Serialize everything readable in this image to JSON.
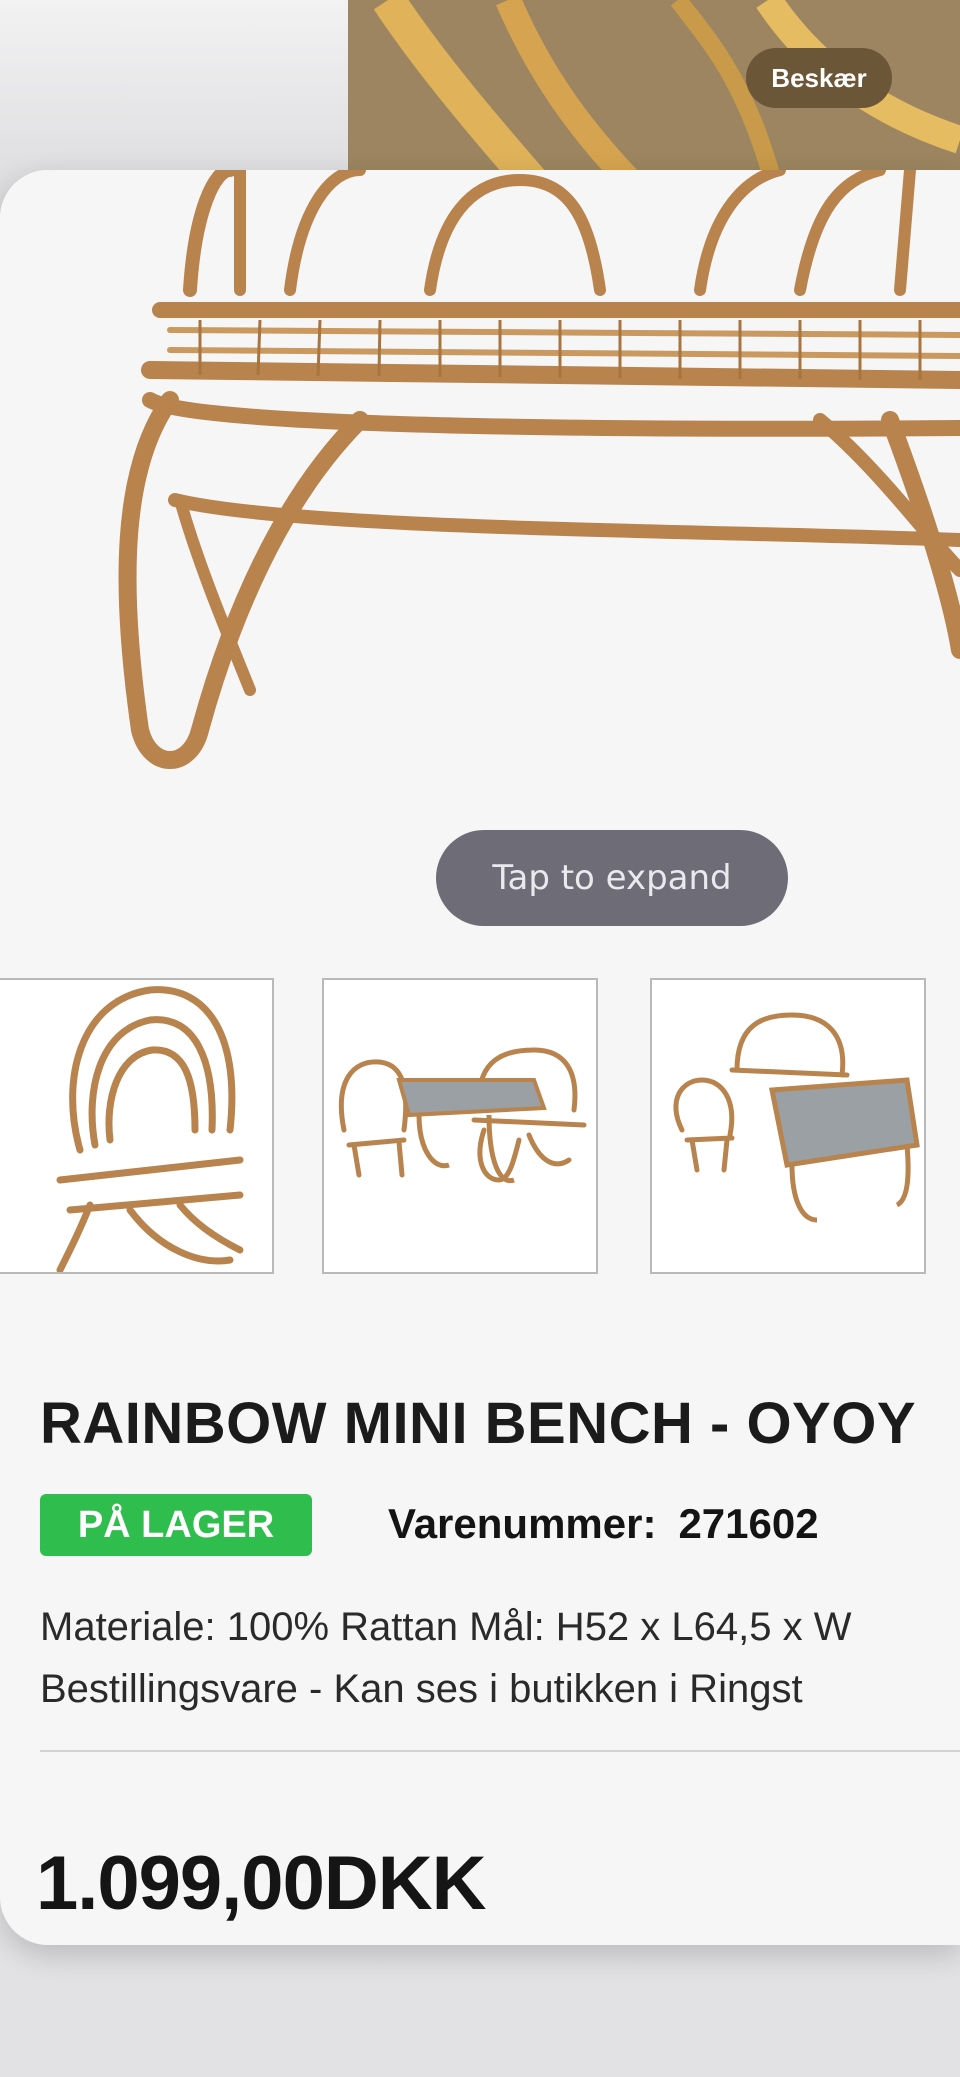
{
  "toolbar": {
    "crop_label": "Beskær"
  },
  "gallery": {
    "expand_label": "Tap to expand"
  },
  "product": {
    "title": "RAINBOW MINI BENCH - OYOY",
    "stock_label": "PÅ LAGER",
    "sku_label": "Varenummer:",
    "sku_value": "271602",
    "description_line1": "Materiale: 100% Rattan Mål: H52 x L64,5 x W",
    "description_line2": "Bestillingsvare - Kan ses i butikken i Ringst",
    "price": "1.099,00DKK"
  },
  "colors": {
    "accent_stock": "#2fbe4d",
    "rattan": "#b8834d",
    "pill_bg": "#6e6d77"
  }
}
